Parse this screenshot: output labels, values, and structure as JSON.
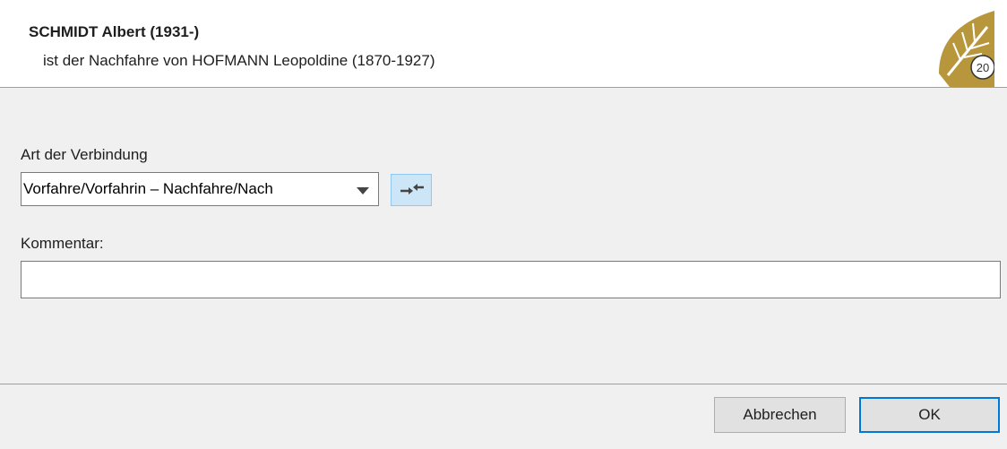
{
  "header": {
    "title": "SCHMIDT Albert (1931-)",
    "subtitle": "ist der Nachfahre von HOFMANN Leopoldine (1870-1927)",
    "logo_badge": "20"
  },
  "form": {
    "connection_label": "Art der Verbindung",
    "connection_value": "Vorfahre/Vorfahrin – Nachfahre/Nach",
    "comment_label": "Kommentar:",
    "comment_value": ""
  },
  "buttons": {
    "cancel": "Abbrechen",
    "ok": "OK"
  },
  "colors": {
    "accent": "#0078d7",
    "logo_gold": "#b8963c",
    "swap_bg": "#cde6f7"
  }
}
